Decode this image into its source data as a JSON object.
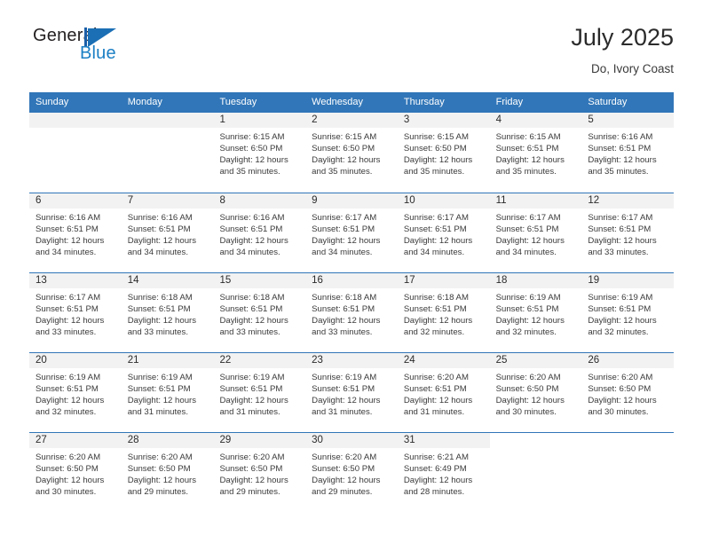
{
  "brand": {
    "line1": "General",
    "line2": "Blue",
    "mark": "triangle-flag-icon"
  },
  "header": {
    "title": "July 2025",
    "subtitle": "Do, Ivory Coast"
  },
  "colors": {
    "header_blue": "#3176b8",
    "brand_blue": "#1b7fc4",
    "day_band_gray": "#f2f2f2"
  },
  "weekdays": [
    "Sunday",
    "Monday",
    "Tuesday",
    "Wednesday",
    "Thursday",
    "Friday",
    "Saturday"
  ],
  "weeks": [
    [
      {
        "day": "",
        "empty": true
      },
      {
        "day": "",
        "empty": true
      },
      {
        "day": "1",
        "sunrise": "Sunrise: 6:15 AM",
        "sunset": "Sunset: 6:50 PM",
        "daylight1": "Daylight: 12 hours",
        "daylight2": "and 35 minutes."
      },
      {
        "day": "2",
        "sunrise": "Sunrise: 6:15 AM",
        "sunset": "Sunset: 6:50 PM",
        "daylight1": "Daylight: 12 hours",
        "daylight2": "and 35 minutes."
      },
      {
        "day": "3",
        "sunrise": "Sunrise: 6:15 AM",
        "sunset": "Sunset: 6:50 PM",
        "daylight1": "Daylight: 12 hours",
        "daylight2": "and 35 minutes."
      },
      {
        "day": "4",
        "sunrise": "Sunrise: 6:15 AM",
        "sunset": "Sunset: 6:51 PM",
        "daylight1": "Daylight: 12 hours",
        "daylight2": "and 35 minutes."
      },
      {
        "day": "5",
        "sunrise": "Sunrise: 6:16 AM",
        "sunset": "Sunset: 6:51 PM",
        "daylight1": "Daylight: 12 hours",
        "daylight2": "and 35 minutes."
      }
    ],
    [
      {
        "day": "6",
        "sunrise": "Sunrise: 6:16 AM",
        "sunset": "Sunset: 6:51 PM",
        "daylight1": "Daylight: 12 hours",
        "daylight2": "and 34 minutes."
      },
      {
        "day": "7",
        "sunrise": "Sunrise: 6:16 AM",
        "sunset": "Sunset: 6:51 PM",
        "daylight1": "Daylight: 12 hours",
        "daylight2": "and 34 minutes."
      },
      {
        "day": "8",
        "sunrise": "Sunrise: 6:16 AM",
        "sunset": "Sunset: 6:51 PM",
        "daylight1": "Daylight: 12 hours",
        "daylight2": "and 34 minutes."
      },
      {
        "day": "9",
        "sunrise": "Sunrise: 6:17 AM",
        "sunset": "Sunset: 6:51 PM",
        "daylight1": "Daylight: 12 hours",
        "daylight2": "and 34 minutes."
      },
      {
        "day": "10",
        "sunrise": "Sunrise: 6:17 AM",
        "sunset": "Sunset: 6:51 PM",
        "daylight1": "Daylight: 12 hours",
        "daylight2": "and 34 minutes."
      },
      {
        "day": "11",
        "sunrise": "Sunrise: 6:17 AM",
        "sunset": "Sunset: 6:51 PM",
        "daylight1": "Daylight: 12 hours",
        "daylight2": "and 34 minutes."
      },
      {
        "day": "12",
        "sunrise": "Sunrise: 6:17 AM",
        "sunset": "Sunset: 6:51 PM",
        "daylight1": "Daylight: 12 hours",
        "daylight2": "and 33 minutes."
      }
    ],
    [
      {
        "day": "13",
        "sunrise": "Sunrise: 6:17 AM",
        "sunset": "Sunset: 6:51 PM",
        "daylight1": "Daylight: 12 hours",
        "daylight2": "and 33 minutes."
      },
      {
        "day": "14",
        "sunrise": "Sunrise: 6:18 AM",
        "sunset": "Sunset: 6:51 PM",
        "daylight1": "Daylight: 12 hours",
        "daylight2": "and 33 minutes."
      },
      {
        "day": "15",
        "sunrise": "Sunrise: 6:18 AM",
        "sunset": "Sunset: 6:51 PM",
        "daylight1": "Daylight: 12 hours",
        "daylight2": "and 33 minutes."
      },
      {
        "day": "16",
        "sunrise": "Sunrise: 6:18 AM",
        "sunset": "Sunset: 6:51 PM",
        "daylight1": "Daylight: 12 hours",
        "daylight2": "and 33 minutes."
      },
      {
        "day": "17",
        "sunrise": "Sunrise: 6:18 AM",
        "sunset": "Sunset: 6:51 PM",
        "daylight1": "Daylight: 12 hours",
        "daylight2": "and 32 minutes."
      },
      {
        "day": "18",
        "sunrise": "Sunrise: 6:19 AM",
        "sunset": "Sunset: 6:51 PM",
        "daylight1": "Daylight: 12 hours",
        "daylight2": "and 32 minutes."
      },
      {
        "day": "19",
        "sunrise": "Sunrise: 6:19 AM",
        "sunset": "Sunset: 6:51 PM",
        "daylight1": "Daylight: 12 hours",
        "daylight2": "and 32 minutes."
      }
    ],
    [
      {
        "day": "20",
        "sunrise": "Sunrise: 6:19 AM",
        "sunset": "Sunset: 6:51 PM",
        "daylight1": "Daylight: 12 hours",
        "daylight2": "and 32 minutes."
      },
      {
        "day": "21",
        "sunrise": "Sunrise: 6:19 AM",
        "sunset": "Sunset: 6:51 PM",
        "daylight1": "Daylight: 12 hours",
        "daylight2": "and 31 minutes."
      },
      {
        "day": "22",
        "sunrise": "Sunrise: 6:19 AM",
        "sunset": "Sunset: 6:51 PM",
        "daylight1": "Daylight: 12 hours",
        "daylight2": "and 31 minutes."
      },
      {
        "day": "23",
        "sunrise": "Sunrise: 6:19 AM",
        "sunset": "Sunset: 6:51 PM",
        "daylight1": "Daylight: 12 hours",
        "daylight2": "and 31 minutes."
      },
      {
        "day": "24",
        "sunrise": "Sunrise: 6:20 AM",
        "sunset": "Sunset: 6:51 PM",
        "daylight1": "Daylight: 12 hours",
        "daylight2": "and 31 minutes."
      },
      {
        "day": "25",
        "sunrise": "Sunrise: 6:20 AM",
        "sunset": "Sunset: 6:50 PM",
        "daylight1": "Daylight: 12 hours",
        "daylight2": "and 30 minutes."
      },
      {
        "day": "26",
        "sunrise": "Sunrise: 6:20 AM",
        "sunset": "Sunset: 6:50 PM",
        "daylight1": "Daylight: 12 hours",
        "daylight2": "and 30 minutes."
      }
    ],
    [
      {
        "day": "27",
        "sunrise": "Sunrise: 6:20 AM",
        "sunset": "Sunset: 6:50 PM",
        "daylight1": "Daylight: 12 hours",
        "daylight2": "and 30 minutes."
      },
      {
        "day": "28",
        "sunrise": "Sunrise: 6:20 AM",
        "sunset": "Sunset: 6:50 PM",
        "daylight1": "Daylight: 12 hours",
        "daylight2": "and 29 minutes."
      },
      {
        "day": "29",
        "sunrise": "Sunrise: 6:20 AM",
        "sunset": "Sunset: 6:50 PM",
        "daylight1": "Daylight: 12 hours",
        "daylight2": "and 29 minutes."
      },
      {
        "day": "30",
        "sunrise": "Sunrise: 6:20 AM",
        "sunset": "Sunset: 6:50 PM",
        "daylight1": "Daylight: 12 hours",
        "daylight2": "and 29 minutes."
      },
      {
        "day": "31",
        "sunrise": "Sunrise: 6:21 AM",
        "sunset": "Sunset: 6:49 PM",
        "daylight1": "Daylight: 12 hours",
        "daylight2": "and 28 minutes."
      },
      {
        "day": "",
        "empty": true,
        "blank": true
      },
      {
        "day": "",
        "empty": true,
        "blank": true
      }
    ]
  ]
}
